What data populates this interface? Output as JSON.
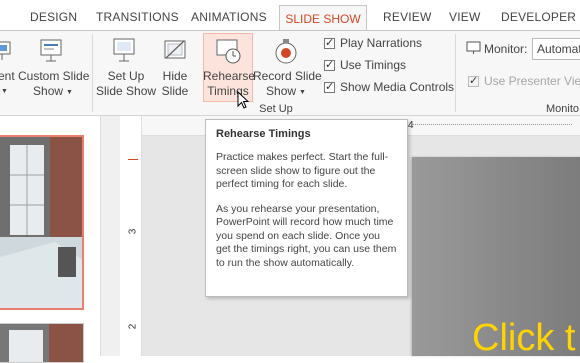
{
  "tabs": [
    {
      "label": "DESIGN"
    },
    {
      "label": "TRANSITIONS"
    },
    {
      "label": "ANIMATIONS"
    },
    {
      "label": "SLIDE SHOW"
    },
    {
      "label": "REVIEW"
    },
    {
      "label": "VIEW"
    },
    {
      "label": "DEVELOPER"
    }
  ],
  "ribbon": {
    "partial_left_label": "ent",
    "custom_slide_show": {
      "line1": "Custom Slide",
      "line2": "Show"
    },
    "set_up_slide_show": {
      "line1": "Set Up",
      "line2": "Slide Show"
    },
    "hide_slide": {
      "line1": "Hide",
      "line2": "Slide"
    },
    "rehearse_timings": {
      "line1": "Rehearse",
      "line2": "Timings"
    },
    "record_slide_show": {
      "line1": "Record Slide",
      "line2": "Show"
    },
    "checkboxes": [
      {
        "label": "Play Narrations",
        "checked": true
      },
      {
        "label": "Use Timings",
        "checked": true
      },
      {
        "label": "Show Media Controls",
        "checked": true
      }
    ],
    "group_setup_label": "Set Up",
    "monitor_label": "Monitor:",
    "monitor_value": "Automat",
    "presenter_view_label": "Use Presenter View",
    "group_monitors_label": "Monito"
  },
  "tooltip": {
    "title": "Rehearse Timings",
    "para1": "Practice makes perfect. Start the full-screen slide show to figure out the perfect timing for each slide.",
    "para2": "As you rehearse your presentation, PowerPoint will record how much time you spend on each slide. Once you get the timings right, you can use them to run the show automatically."
  },
  "ruler": {
    "h_mark": "4",
    "v_mark_1": "3",
    "v_mark_2": "2"
  },
  "slide": {
    "title_partial": "Click t"
  },
  "colors": {
    "accent": "#d24726",
    "title_yellow": "#ffd400"
  }
}
